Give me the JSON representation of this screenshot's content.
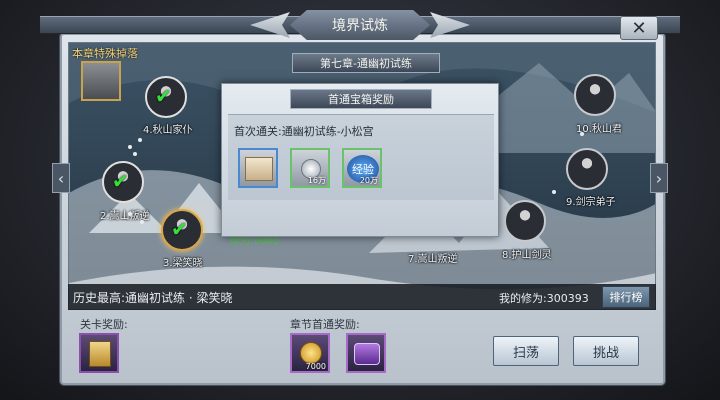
{
  "window": {
    "title": "境界试炼",
    "close_label": "✕"
  },
  "chapter_title": "第七章-通幽初试练",
  "special_drop_label": "本章特殊掉落",
  "nodes": [
    {
      "label": "2.嵩山叛逆",
      "status": "cleared"
    },
    {
      "label": "3.梁笑晓",
      "status": "current"
    },
    {
      "label": "4.秋山家仆",
      "status": "cleared"
    },
    {
      "label": "7.嵩山叛逆",
      "status": "locked"
    },
    {
      "label": "8.护山剑灵",
      "status": "locked"
    },
    {
      "label": "9.剑宗弟子",
      "status": "locked"
    },
    {
      "label": "10.秋山君",
      "status": "locked"
    }
  ],
  "map_hint": "修为:3000",
  "popup": {
    "title": "首通宝箱奖励",
    "subtitle": "首次通关:通幽初试练-小松宫",
    "rewards": [
      {
        "icon": "scroll-icon",
        "amount": ""
      },
      {
        "icon": "silver-coin-icon",
        "amount": "16万"
      },
      {
        "icon": "exp-orb-icon",
        "amount": "20万",
        "icon_text": "经验"
      }
    ]
  },
  "history": {
    "text": "历史最高:通幽初试练 · 梁笑晓",
    "power": "我的修为:300393"
  },
  "rank_button": "排行榜",
  "stage_reward_label": "关卡奖励:",
  "chapter_reward_label": "章节首通奖励:",
  "chapter_rewards": [
    {
      "icon": "gold-coin-icon",
      "amount": "7000"
    },
    {
      "icon": "title-badge-icon",
      "amount": ""
    }
  ],
  "sweep_button": "扫荡",
  "challenge_button": "挑战",
  "colors": {
    "accent_gold": "#d9a64a",
    "cleared_green": "#36e03a",
    "reward_purple": "#8b4fb0"
  }
}
